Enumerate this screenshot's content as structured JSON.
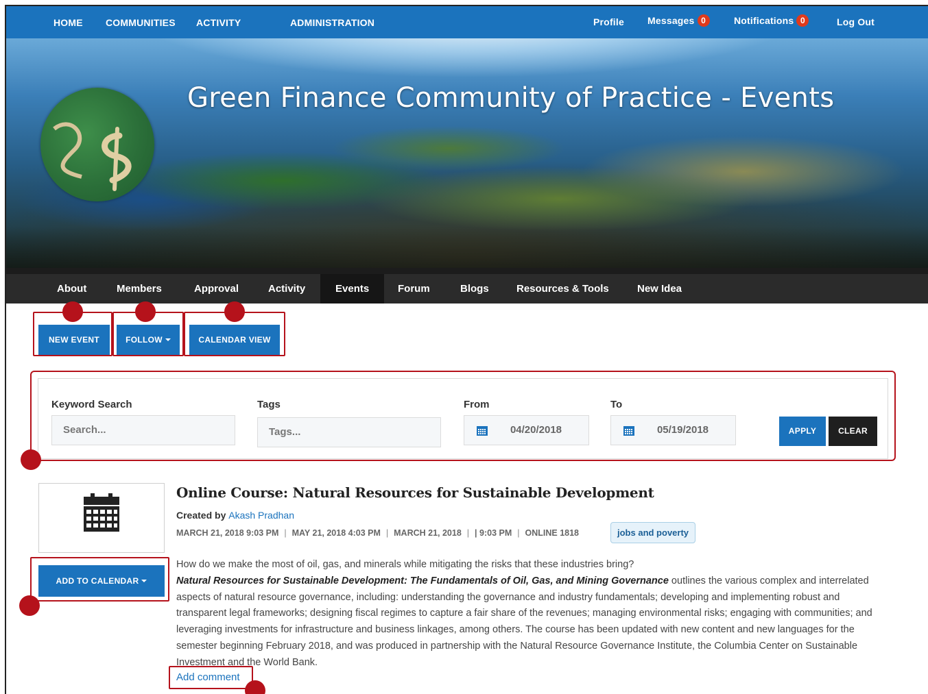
{
  "topnav": {
    "left": [
      "HOME",
      "COMMUNITIES",
      "ACTIVITY",
      "ADMINISTRATION"
    ],
    "profile": "Profile",
    "messages": "Messages",
    "messages_count": "0",
    "notifications": "Notifications",
    "notifications_count": "0",
    "logout": "Log Out"
  },
  "hero": {
    "title": "Green Finance Community of Practice - Events"
  },
  "subnav": {
    "tabs": [
      "About",
      "Members",
      "Approval",
      "Activity",
      "Events",
      "Forum",
      "Blogs",
      "Resources & Tools",
      "New Idea"
    ],
    "active": "Events"
  },
  "actions": {
    "new_event": "NEW EVENT",
    "follow": "FOLLOW",
    "calendar_view": "CALENDAR VIEW"
  },
  "filter": {
    "keyword_label": "Keyword Search",
    "keyword_placeholder": "Search...",
    "tags_label": "Tags",
    "tags_placeholder": "Tags...",
    "from_label": "From",
    "from_value": "04/20/2018",
    "to_label": "To",
    "to_value": "05/19/2018",
    "apply": "APPLY",
    "clear": "CLEAR"
  },
  "event": {
    "title": "Online Course: Natural Resources for Sustainable Development",
    "created_by_label": "Created by",
    "author": "Akash Pradhan",
    "meta": [
      "MARCH 21, 2018 9:03 PM",
      "MAY 21, 2018 4:03 PM",
      "MARCH 21, 2018",
      "| 9:03 PM",
      "ONLINE 1818"
    ],
    "tag": "jobs and poverty",
    "add_to_calendar": "ADD TO CALENDAR",
    "intro": "How do we make the most of oil, gas, and minerals while mitigating the risks that these industries bring?",
    "book_title": "Natural Resources for Sustainable Development: The Fundamentals of Oil, Gas, and Mining Governance",
    "body": " outlines the various complex and interrelated aspects of natural resource governance, including: understanding the governance and industry fundamentals; developing and implementing robust and transparent legal frameworks; designing fiscal regimes to capture a fair share of the revenues; managing environmental risks; engaging with communities; and leveraging investments for infrastructure and business linkages, among others. The course has been updated with new content and new languages for the semester beginning February 2018, and was produced in partnership with the Natural Resource Governance Institute, the Columbia Center on Sustainable Investment and the World Bank.",
    "add_comment": "Add comment"
  },
  "colors": {
    "primary": "#1b73bd",
    "callout": "#b5121b",
    "subnav": "#2b2b2b",
    "badge": "#e03a1c"
  }
}
